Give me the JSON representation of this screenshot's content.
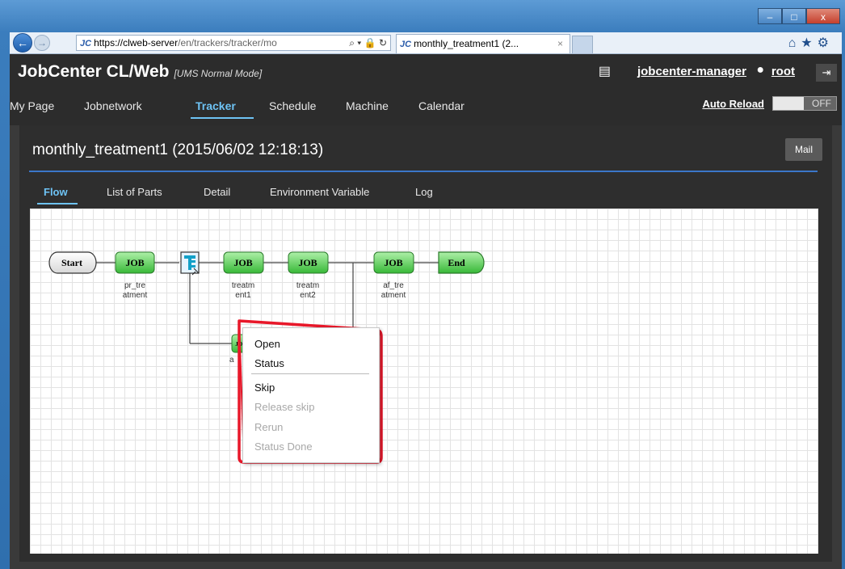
{
  "browser": {
    "url_host": "https://clweb-server",
    "url_path": "/en/trackers/tracker/mo",
    "url_icons": "⌕ ▾ 🔒 ↻",
    "tab_title": "monthly_treatment1 (2...",
    "tab_close": "×",
    "favicon_text": "JC",
    "toolbar_icons": "⌂★⚙"
  },
  "window_controls": {
    "minimize": "–",
    "maximize": "□",
    "close": "x"
  },
  "header": {
    "app_name": "JobCenter CL/Web",
    "mode": "[UMS Normal Mode]",
    "server": "jobcenter-manager",
    "user": "root",
    "auto_reload_label": "Auto Reload",
    "auto_reload_state": "OFF"
  },
  "menu": [
    "My Page",
    "Jobnetwork",
    "Tracker",
    "Schedule",
    "Machine",
    "Calendar"
  ],
  "menu_active": "Tracker",
  "page": {
    "title": "monthly_treatment1 (2015/06/02 12:18:13)",
    "mail_button": "Mail",
    "tabs": [
      "Flow",
      "List of Parts",
      "Detail",
      "Environment Variable",
      "Log"
    ],
    "active_tab": "Flow"
  },
  "flow": {
    "start": "Start",
    "end": "End",
    "job_text": "JOB",
    "jobs": [
      {
        "label_line1": "pr_tre",
        "label_line2": "atment"
      },
      {
        "label_line1": "treatm",
        "label_line2": "ent1"
      },
      {
        "label_line1": "treatm",
        "label_line2": "ent2"
      },
      {
        "label_line1": "af_tre",
        "label_line2": "atment"
      }
    ],
    "branch_job_text": "JOB",
    "branch_job_label": "a"
  },
  "context_menu": {
    "items": [
      {
        "label": "Open",
        "enabled": true
      },
      {
        "label": "Status",
        "enabled": true
      },
      {
        "label": "Skip",
        "enabled": true
      },
      {
        "label": "Release skip",
        "enabled": false
      },
      {
        "label": "Rerun",
        "enabled": false
      },
      {
        "label": "Status Done",
        "enabled": false
      }
    ]
  },
  "colors": {
    "job_node": "#5fcf5f",
    "accent": "#6ec3f5",
    "highlight": "#e8182a"
  }
}
